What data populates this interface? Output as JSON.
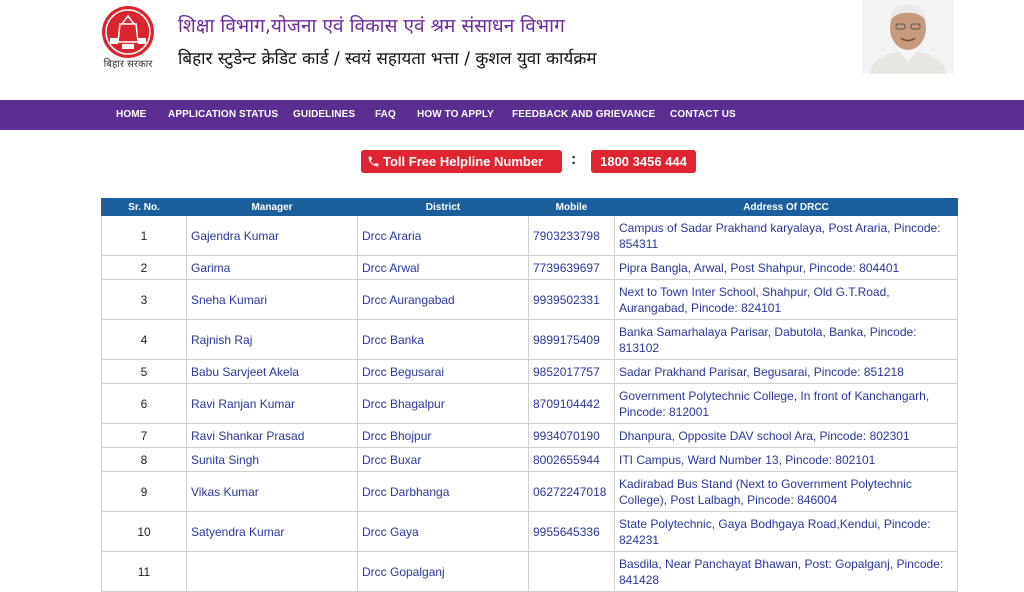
{
  "header": {
    "logo_caption": "बिहार सरकार",
    "title_line1": "शिक्षा विभाग,योजना एवं विकास एवं श्रम संसाधन विभाग",
    "title_line2": "बिहार स्टुडेन्ट क्रेडिट कार्ड / स्वयं सहायता भत्ता / कुशल युवा कार्यक्रम"
  },
  "nav": {
    "items": [
      "HOME",
      "APPLICATION STATUS",
      "GUIDELINES",
      "FAQ",
      "HOW TO APPLY",
      "FEEDBACK AND GRIEVANCE",
      "CONTACT US"
    ]
  },
  "helpline": {
    "label": "Toll Free Helpline Number",
    "separator": ":",
    "number": "1800 3456 444"
  },
  "table": {
    "headers": [
      "Sr. No.",
      "Manager",
      "District",
      "Mobile",
      "Address Of DRCC"
    ],
    "rows": [
      {
        "sr": "1",
        "manager": "Gajendra Kumar",
        "district": "Drcc Araria",
        "mobile": "7903233798",
        "address": "Campus of Sadar Prakhand karyalaya, Post Araria, Pincode: 854311"
      },
      {
        "sr": "2",
        "manager": "Garima",
        "district": "Drcc Arwal",
        "mobile": "7739639697",
        "address": "Pipra Bangla, Arwal, Post Shahpur, Pincode: 804401"
      },
      {
        "sr": "3",
        "manager": "Sneha Kumari",
        "district": "Drcc Aurangabad",
        "mobile": "9939502331",
        "address": "Next to Town Inter School, Shahpur, Old G.T.Road, Aurangabad, Pincode: 824101"
      },
      {
        "sr": "4",
        "manager": "Rajnish Raj",
        "district": "Drcc Banka",
        "mobile": "9899175409",
        "address": "Banka Samarhalaya Parisar, Dabutola, Banka, Pincode: 813102"
      },
      {
        "sr": "5",
        "manager": "Babu Sarvjeet Akela",
        "district": "Drcc Begusarai",
        "mobile": "9852017757",
        "address": "Sadar Prakhand Parisar, Begusarai, Pincode: 851218"
      },
      {
        "sr": "6",
        "manager": "Ravi Ranjan Kumar",
        "district": "Drcc Bhagalpur",
        "mobile": "8709104442",
        "address": "Government Polytechnic College, In front of Kanchangarh, Pincode: 812001"
      },
      {
        "sr": "7",
        "manager": "Ravi Shankar Prasad",
        "district": "Drcc Bhojpur",
        "mobile": "9934070190",
        "address": "Dhanpura, Opposite DAV school Ara, Pincode: 802301"
      },
      {
        "sr": "8",
        "manager": "Sunita Singh",
        "district": "Drcc Buxar",
        "mobile": "8002655944",
        "address": "ITI Campus, Ward Number 13, Pincode: 802101"
      },
      {
        "sr": "9",
        "manager": "Vikas Kumar",
        "district": "Drcc Darbhanga",
        "mobile": "06272247018",
        "address": "Kadirabad Bus Stand (Next to Government Polytechnic College), Post Lalbagh, Pincode: 846004"
      },
      {
        "sr": "10",
        "manager": "Satyendra Kumar",
        "district": "Drcc Gaya",
        "mobile": "9955645336",
        "address": "State Polytechnic, Gaya Bodhgaya Road,Kendui, Pincode: 824231"
      },
      {
        "sr": "11",
        "manager": "",
        "district": "Drcc Gopalganj",
        "mobile": "",
        "address": "Basdila, Near Panchayat Bhawan, Post: Gopalganj, Pincode: 841428"
      }
    ]
  },
  "icons": {
    "logo": "bihar-emblem-icon",
    "phone": "phone-icon",
    "photo": "person-photo"
  },
  "colors": {
    "nav_bg": "#5b2d90",
    "title_purple": "#6d2c9b",
    "helpline_red": "#e02431",
    "table_header": "#1a5f9c",
    "link_blue": "#2c36a0"
  }
}
